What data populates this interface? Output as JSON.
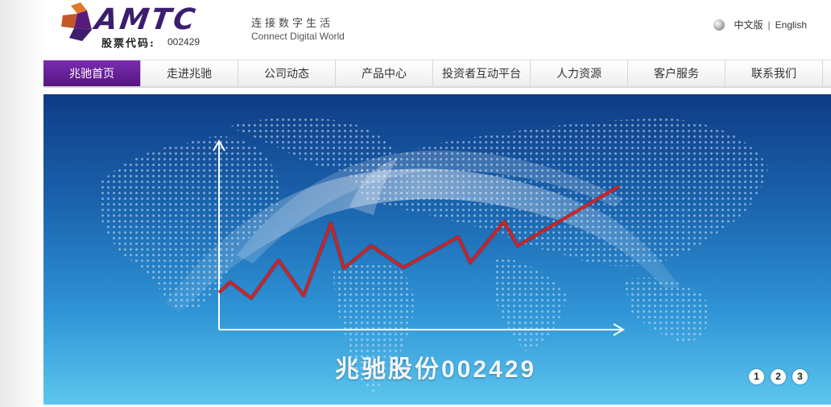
{
  "header": {
    "logo_text": "AMTC",
    "stock_label": "股票代码:",
    "stock_code": "002429",
    "slogan_cn": "连接数字生活",
    "slogan_en": "Connect Digital World",
    "lang_cn": "中文版",
    "lang_sep": "|",
    "lang_en": "English"
  },
  "nav": {
    "items": [
      {
        "label": "兆驰首页",
        "active": true
      },
      {
        "label": "走进兆驰"
      },
      {
        "label": "公司动态"
      },
      {
        "label": "产品中心"
      },
      {
        "label": "投资者互动平台"
      },
      {
        "label": "人力资源"
      },
      {
        "label": "客户服务"
      },
      {
        "label": "联系我们"
      }
    ]
  },
  "banner": {
    "caption": "兆驰股份002429",
    "pager": [
      "1",
      "2",
      "3"
    ]
  },
  "colors": {
    "brand_purple": "#3c1d6e",
    "nav_active": "#6a1f9a",
    "logo_orange": "#e07a2b",
    "chart_line": "#c91e1e"
  }
}
